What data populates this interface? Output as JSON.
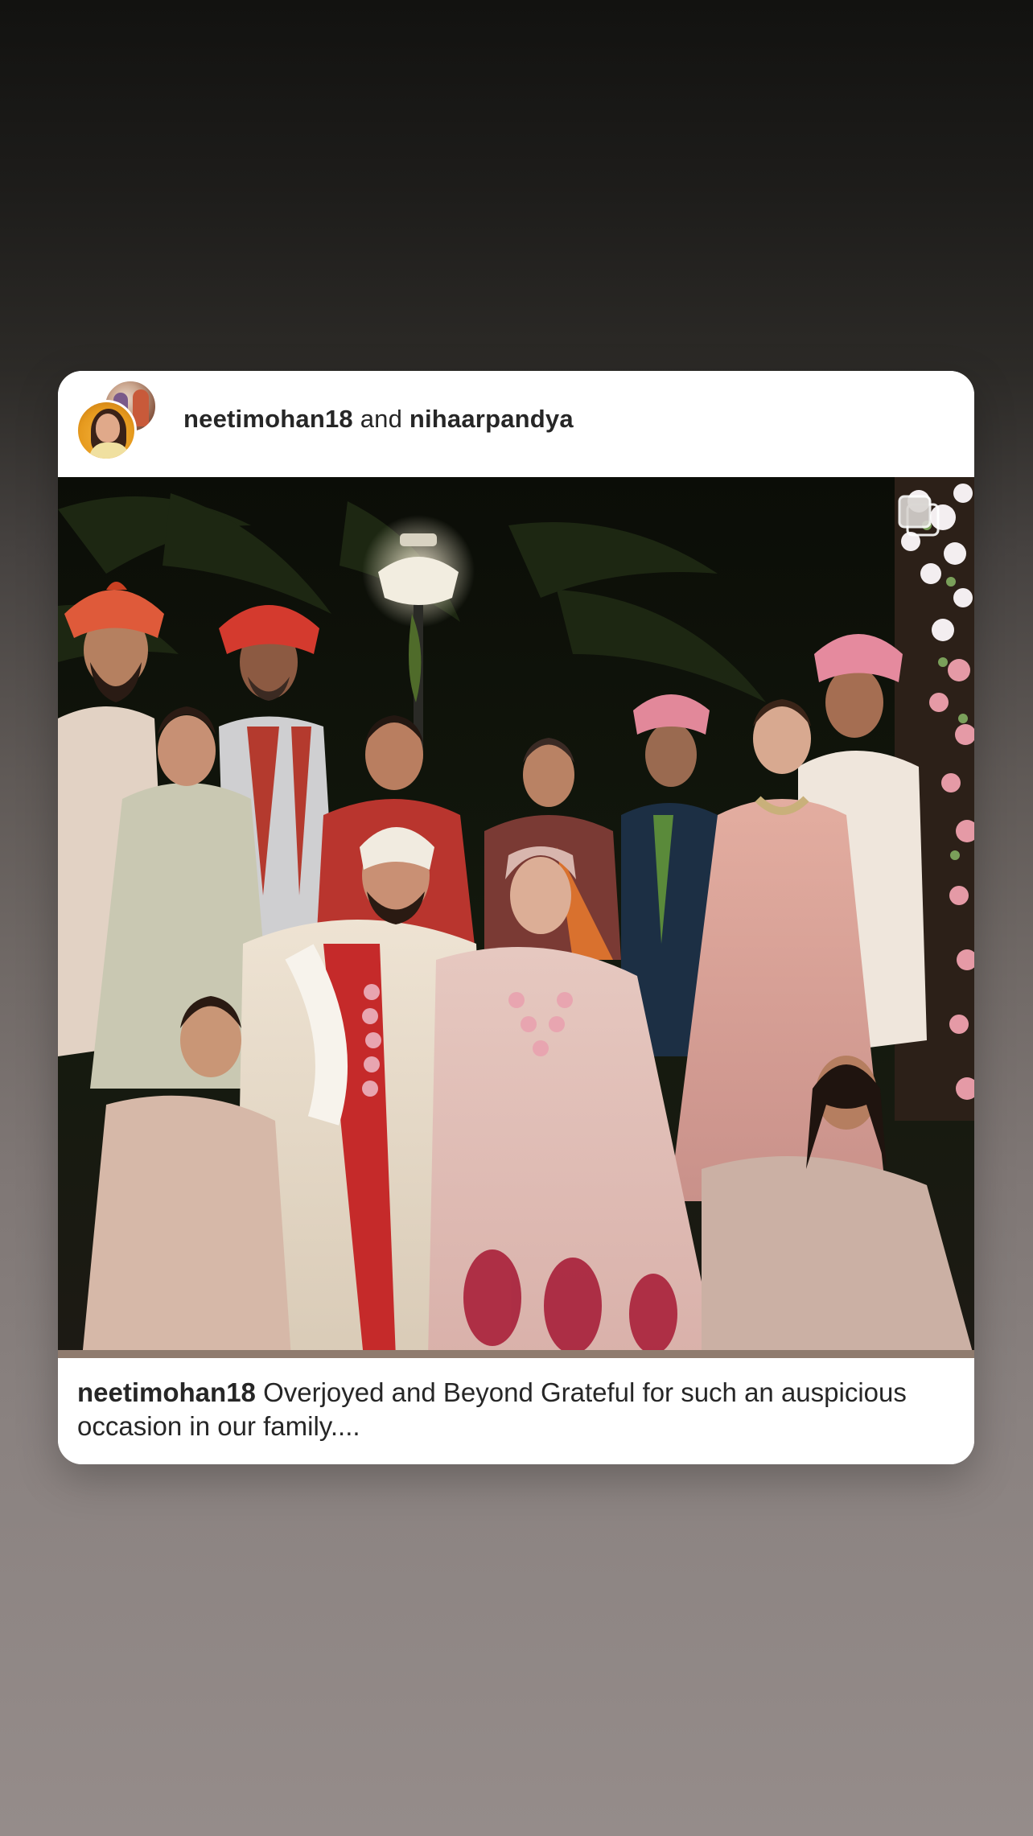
{
  "post": {
    "author_1": "neetimohan18",
    "joiner": "and",
    "author_2": "nihaarpandya",
    "caption_user": "neetimohan18",
    "caption_text": "Overjoyed and Beyond Grateful for such an auspicious occasion in our family...."
  },
  "icons": {
    "photo_overlay": "multi-photo-icon"
  },
  "colors": {
    "card_background": "#ffffff",
    "text_primary": "#262626",
    "page_gradient_top": "#121210",
    "page_gradient_bottom": "#958c8a"
  }
}
